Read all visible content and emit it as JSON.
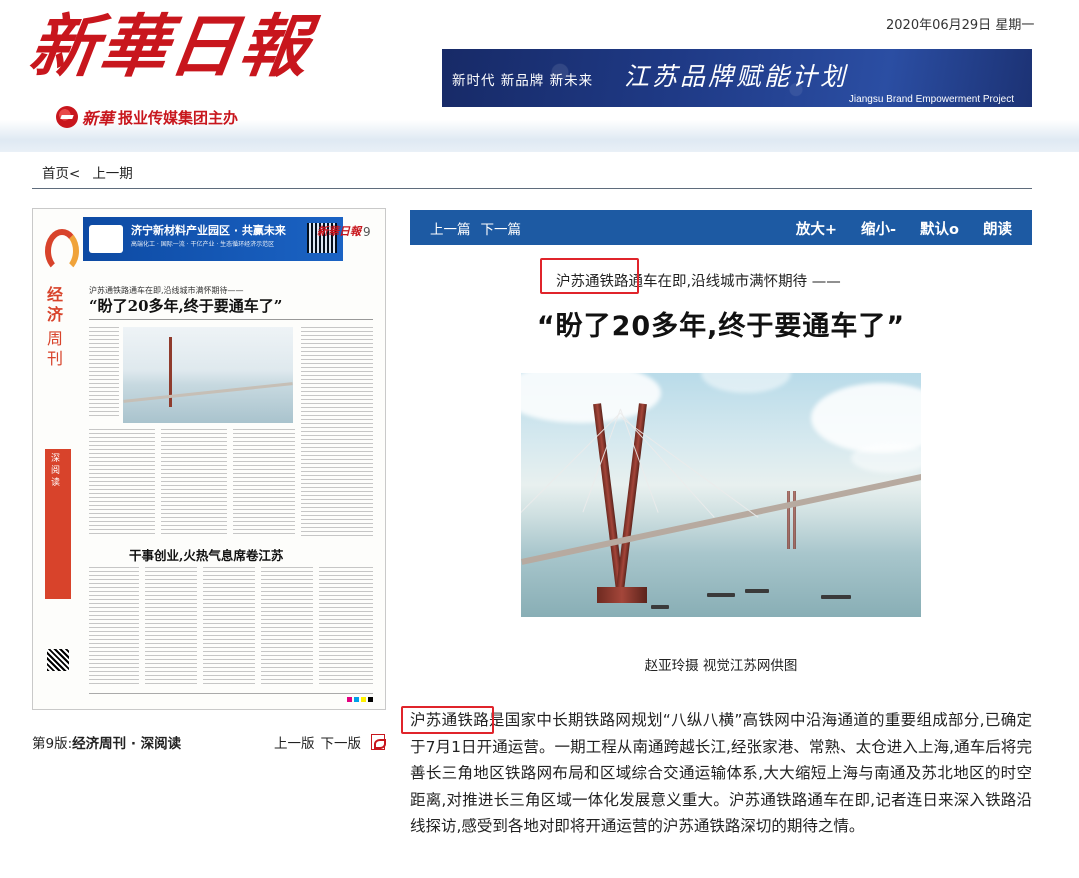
{
  "header": {
    "masthead": "新華日報",
    "publisher_brand": "新華",
    "publisher_text": "报业传媒集团主办",
    "date": "2020年06月29日",
    "weekday": "星期一",
    "banner": {
      "slogans": "新时代  新品牌  新未来",
      "title": "江苏品牌赋能计划",
      "subtitle": "Jiangsu Brand Empowerment Project"
    }
  },
  "breadcrumb": {
    "home": "首页<",
    "prev_issue": "上一期"
  },
  "page_thumbnail": {
    "ad_title": "济宁新材料产业园区 · 共赢未来",
    "ad_sub": "高端化工 · 国际一流 · 干亿产业 · 生态循环经济示范区",
    "masthead": "新華日報",
    "page_number": "9",
    "column_name_1": "经济",
    "column_name_2": "周刊",
    "deep_read": "深阅读",
    "kicker": "沪苏通铁路通车在即,沿线城市满怀期待——",
    "headline": "“盼了20多年,终于要通车了”",
    "subheadline": "干事创业,火热气息席卷江苏"
  },
  "page_caption": {
    "prefix": "第9版:",
    "name": "经济周刊 · 深阅读"
  },
  "page_nav": {
    "prev": "上一版",
    "next": "下一版"
  },
  "toolbar": {
    "prev_article": "上一篇",
    "next_article": "下一篇",
    "zoom_in": "放大+",
    "zoom_out": "缩小-",
    "default": "默认o",
    "read_aloud": "朗读"
  },
  "article": {
    "kicker": "沪苏通铁路通车在即,沿线城市满怀期待 ——",
    "headline": "“盼了20多年,终于要通车了”",
    "photo_credit": "赵亚玲摄 视觉江苏网供图",
    "body": "沪苏通铁路是国家中长期铁路网规划“八纵八横”高铁网中沿海通道的重要组成部分,已确定于7月1日开通运营。一期工程从南通跨越长江,经张家港、常熟、太仓进入上海,通车后将完善长三角地区铁路网布局和区域综合交通运输体系,大大缩短上海与南通及苏北地区的时空距离,对推进长三角区域一体化发展意义重大。沪苏通铁路通车在即,记者连日来深入铁路沿线探访,感受到各地对即将开通运营的沪苏通铁路深切的期待之情。"
  },
  "colors": {
    "brand_red": "#c8161d",
    "toolbar_blue": "#1d5aa3",
    "highlight_red": "#e0242b"
  },
  "icons": {
    "pdf": "pdf-icon",
    "publisher_logo": "xinhua-logo-icon"
  }
}
